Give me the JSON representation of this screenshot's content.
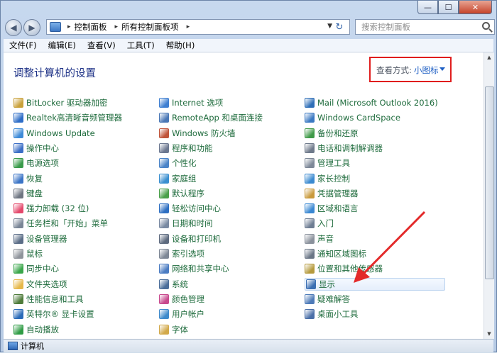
{
  "window": {
    "minimize": "—",
    "maximize": "☐",
    "close": "✕"
  },
  "nav": {
    "back": "◀",
    "forward": "▶",
    "breadcrumb": [
      "控制面板",
      "所有控制面板项"
    ],
    "separator": "▸",
    "dropdown": "▼",
    "refresh": "↻",
    "search_placeholder": "搜索控制面板"
  },
  "menu": [
    "文件(F)",
    "编辑(E)",
    "查看(V)",
    "工具(T)",
    "帮助(H)"
  ],
  "content": {
    "title": "调整计算机的设置",
    "view_by_label": "查看方式:",
    "view_by_value": "小图标"
  },
  "columns": [
    [
      {
        "label": "BitLocker 驱动器加密",
        "icon": "bitlocker-icon",
        "color": "#c9a13a"
      },
      {
        "label": "Realtek高清晰音频管理器",
        "icon": "realtek-audio-icon",
        "color": "#2d6dc7"
      },
      {
        "label": "Windows Update",
        "icon": "windows-update-icon",
        "color": "#3e8bd8"
      },
      {
        "label": "操作中心",
        "icon": "flag-icon",
        "color": "#3c6fc6"
      },
      {
        "label": "电源选项",
        "icon": "power-icon",
        "color": "#3a9b4b"
      },
      {
        "label": "恢复",
        "icon": "recovery-icon",
        "color": "#3b74c6"
      },
      {
        "label": "键盘",
        "icon": "keyboard-icon",
        "color": "#6e7581"
      },
      {
        "label": "强力卸载 (32 位)",
        "icon": "uninstall-icon",
        "color": "#e4486b"
      },
      {
        "label": "任务栏和「开始」菜单",
        "icon": "taskbar-icon",
        "color": "#7a8596"
      },
      {
        "label": "设备管理器",
        "icon": "device-manager-icon",
        "color": "#5b6d87"
      },
      {
        "label": "鼠标",
        "icon": "mouse-icon",
        "color": "#8f949b"
      },
      {
        "label": "同步中心",
        "icon": "sync-icon",
        "color": "#39a64a"
      },
      {
        "label": "文件夹选项",
        "icon": "folder-icon",
        "color": "#e6b84a"
      },
      {
        "label": "性能信息和工具",
        "icon": "performance-icon",
        "color": "#4f7c3b"
      },
      {
        "label": "英特尔® 显卡设置",
        "icon": "intel-graphics-icon",
        "color": "#2a6bb8"
      },
      {
        "label": "自动播放",
        "icon": "autoplay-icon",
        "color": "#2f9c45"
      }
    ],
    [
      {
        "label": "Internet 选项",
        "icon": "internet-options-icon",
        "color": "#3f7fd1"
      },
      {
        "label": "RemoteApp 和桌面连接",
        "icon": "remoteapp-icon",
        "color": "#4a78b6"
      },
      {
        "label": "Windows 防火墙",
        "icon": "firewall-icon",
        "color": "#c0543a"
      },
      {
        "label": "程序和功能",
        "icon": "programs-icon",
        "color": "#6c7890"
      },
      {
        "label": "个性化",
        "icon": "personalization-icon",
        "color": "#4b84c8"
      },
      {
        "label": "家庭组",
        "icon": "homegroup-icon",
        "color": "#3a8fd0"
      },
      {
        "label": "默认程序",
        "icon": "default-programs-icon",
        "color": "#4aa04a"
      },
      {
        "label": "轻松访问中心",
        "icon": "ease-of-access-icon",
        "color": "#2e6fc2"
      },
      {
        "label": "日期和时间",
        "icon": "calendar-icon",
        "color": "#7a8aa2"
      },
      {
        "label": "设备和打印机",
        "icon": "printer-icon",
        "color": "#5e6b7f"
      },
      {
        "label": "索引选项",
        "icon": "indexing-icon",
        "color": "#7e8795"
      },
      {
        "label": "网络和共享中心",
        "icon": "network-icon",
        "color": "#4b7cc2"
      },
      {
        "label": "系统",
        "icon": "system-icon",
        "color": "#4c6e9a"
      },
      {
        "label": "颜色管理",
        "icon": "color-management-icon",
        "color": "#c84a8e"
      },
      {
        "label": "用户帐户",
        "icon": "user-accounts-icon",
        "color": "#3f8acb"
      },
      {
        "label": "字体",
        "icon": "fonts-icon",
        "color": "#d2a94a"
      }
    ],
    [
      {
        "label": "Mail (Microsoft Outlook 2016)",
        "icon": "mail-icon",
        "color": "#2f6fb8"
      },
      {
        "label": "Windows CardSpace",
        "icon": "cardspace-icon",
        "color": "#3b79c2"
      },
      {
        "label": "备份和还原",
        "icon": "backup-icon",
        "color": "#3f9a48"
      },
      {
        "label": "电话和调制解调器",
        "icon": "phone-modem-icon",
        "color": "#6f7a8b"
      },
      {
        "label": "管理工具",
        "icon": "admin-tools-icon",
        "color": "#7d8898"
      },
      {
        "label": "家长控制",
        "icon": "parental-controls-icon",
        "color": "#3b8ad0"
      },
      {
        "label": "凭据管理器",
        "icon": "credential-manager-icon",
        "color": "#c99a3c"
      },
      {
        "label": "区域和语言",
        "icon": "globe-icon",
        "color": "#3a88d2"
      },
      {
        "label": "入门",
        "icon": "getting-started-icon",
        "color": "#6e7d93"
      },
      {
        "label": "声音",
        "icon": "sound-icon",
        "color": "#8a919c"
      },
      {
        "label": "通知区域图标",
        "icon": "notification-icon",
        "color": "#6a7686"
      },
      {
        "label": "位置和其他传感器",
        "icon": "sensor-icon",
        "color": "#b59a3d"
      },
      {
        "label": "显示",
        "icon": "display-icon",
        "color": "#3b6fb3",
        "selected": true
      },
      {
        "label": "疑难解答",
        "icon": "troubleshooting-icon",
        "color": "#4e7bb8"
      },
      {
        "label": "桌面小工具",
        "icon": "gadgets-icon",
        "color": "#4a6fa8"
      }
    ]
  ],
  "status": {
    "label": "计算机"
  }
}
